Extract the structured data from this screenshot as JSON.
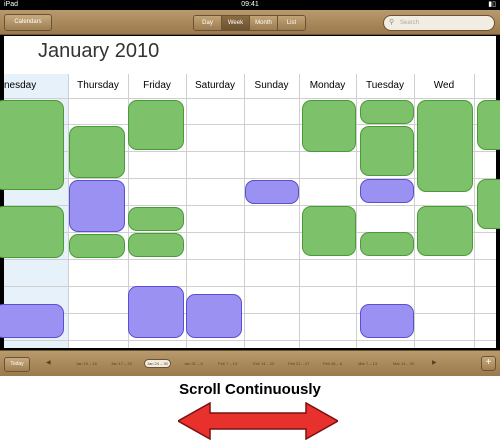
{
  "status": {
    "left": "iPad",
    "time": "09:41"
  },
  "toolbar": {
    "calendars": "Calendars",
    "views": [
      "Day",
      "Week",
      "Month",
      "List"
    ],
    "active_view": "Week",
    "search_placeholder": "Search"
  },
  "calendar": {
    "month_title": "January 2010",
    "days": [
      "nesday",
      "Thursday",
      "Friday",
      "Saturday",
      "Sunday",
      "Monday",
      "Tuesday",
      "Wed"
    ],
    "highlighted_day": "nesday"
  },
  "bottom": {
    "today": "Today",
    "weeks": [
      "Jan 10 – 16",
      "Jan 17 – 23",
      "Jan 24 – 30",
      "Jan 31 – 6",
      "Feb 7 – 13",
      "Feb 14 – 20",
      "Feb 21 – 27",
      "Feb 28 – 6",
      "Mar 7 – 13",
      "Mar 14 – 20"
    ],
    "selected_week": "Jan 24 – 30",
    "add": "+"
  },
  "caption": "Scroll Continuously",
  "colors": {
    "event_green": "#7dc26b",
    "event_purple": "#9b91f2",
    "arrow_red": "#e8312d",
    "wood": "#a8895c"
  }
}
